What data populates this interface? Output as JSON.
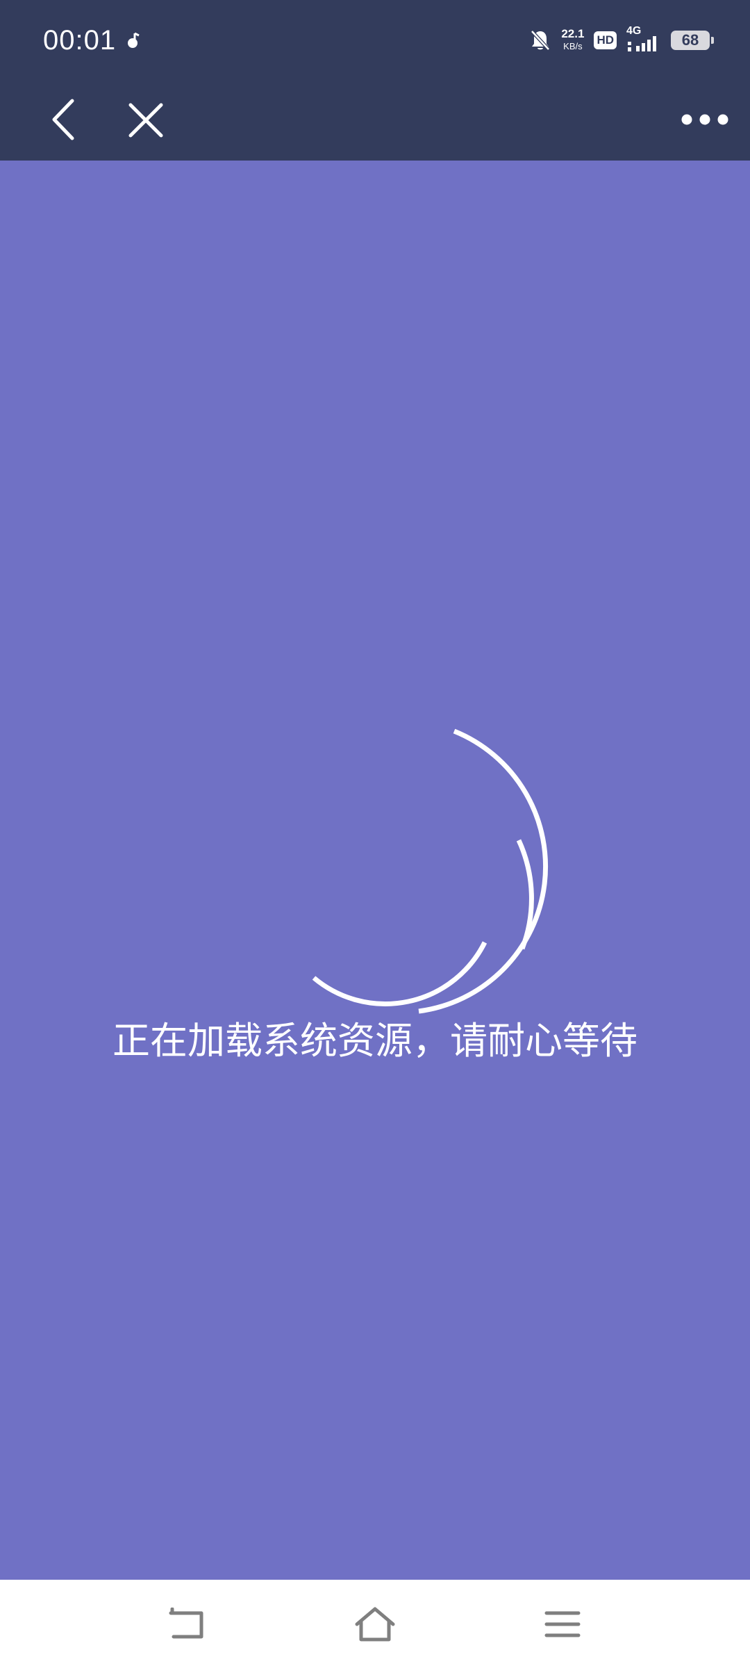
{
  "status_bar": {
    "time": "00:01",
    "net_speed_value": "22.1",
    "net_speed_unit": "KB/s",
    "hd_label": "HD",
    "network_type": "4G",
    "battery_level": "68",
    "icons": [
      "app-notification-icon",
      "mute-bell-icon",
      "signal-icon",
      "battery-icon"
    ]
  },
  "nav_bar": {
    "icons": [
      "back-arrow-icon",
      "close-icon",
      "more-dots-icon"
    ]
  },
  "main": {
    "loading_text": "正在加载系统资源，请耐心等待"
  },
  "system_nav": {
    "icons": [
      "system-back-icon",
      "home-icon",
      "menu-icon"
    ]
  },
  "colors": {
    "header_bg": "#333c5c",
    "content_bg": "#7071c5",
    "text": "#ffffff"
  }
}
